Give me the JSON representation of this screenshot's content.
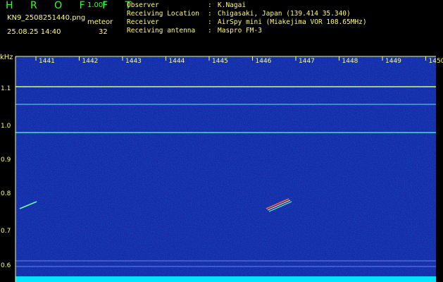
{
  "header": {
    "brand": "H R O F F T",
    "version": "1.00f",
    "filename": "KN9_2508251440.png",
    "datetime": "25.08.25 14:40",
    "meteor_label": "meteor",
    "meteor_count": "32",
    "fields": [
      {
        "key": "Observer",
        "value": "K.Nagai"
      },
      {
        "key": "Receiving Location",
        "value": "Chigasaki, Japan (139.414 35.340)"
      },
      {
        "key": "Receiver",
        "value": "AirSpy mini (Miakejima VOR 108.65MHz)"
      },
      {
        "key": "Receiving antenna",
        "value": "Maspro FM-3"
      }
    ]
  },
  "spectrogram": {
    "y_unit": "kHz",
    "y_ticks": [
      "1.1",
      "1.0",
      "0.9",
      "0.8",
      "0.7",
      "0.6"
    ],
    "x_ticks": [
      "1441",
      "1442",
      "1443",
      "1444",
      "1445",
      "1446",
      "1447",
      "1448",
      "1449",
      "1450"
    ],
    "colors": {
      "axis": "#ffff66",
      "background": "#1a2aa8",
      "bottom_band": "#00e5ff",
      "line": "#55ffcc"
    }
  }
}
